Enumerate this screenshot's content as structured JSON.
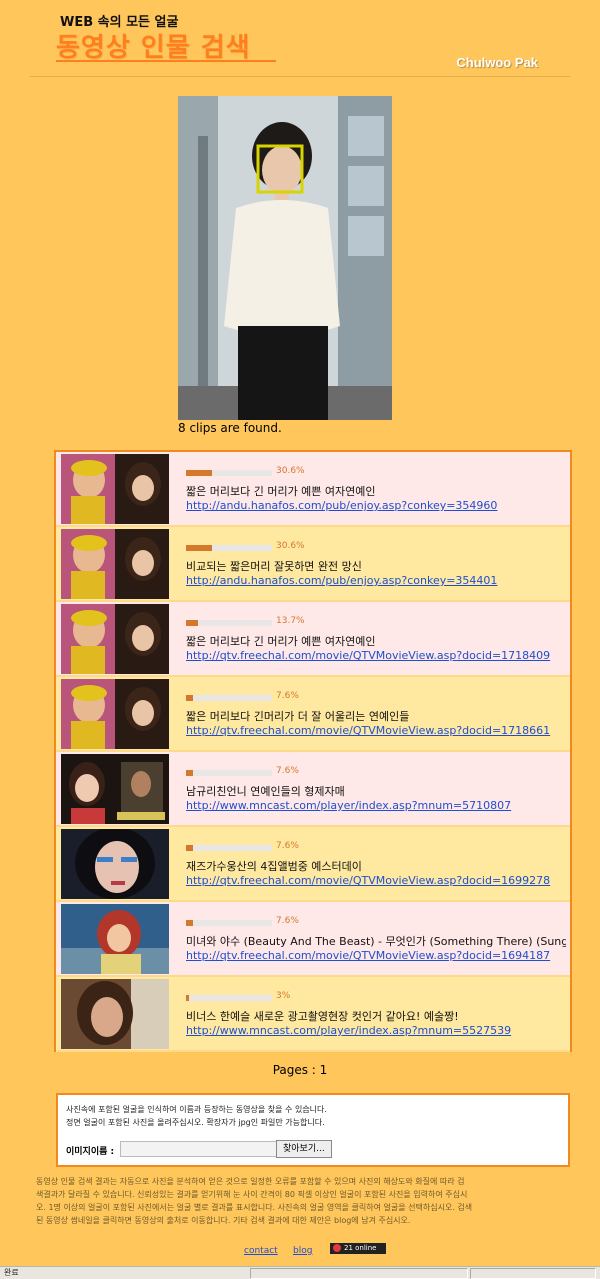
{
  "header": {
    "subtitle": "WEB 속의 모든 얼굴",
    "title": "동영상 인물 검색",
    "author": "Chulwoo Pak"
  },
  "query": {
    "clips_found": "8 clips are found."
  },
  "results": [
    {
      "percent": "30.6%",
      "score": 0.306,
      "title": "짧은 머리보다 긴 머리가 예쁜 여자연예인",
      "url": "http://andu.hanafos.com/pub/enjoy.asp?conkey=354960"
    },
    {
      "percent": "30.6%",
      "score": 0.306,
      "title": "비교되는 짧은머리 잘못하면 완전 망신",
      "url": "http://andu.hanafos.com/pub/enjoy.asp?conkey=354401"
    },
    {
      "percent": "13.7%",
      "score": 0.137,
      "title": "짧은 머리보다 긴 머리가 예쁜 여자연예인",
      "url": "http://qtv.freechal.com/movie/QTVMovieView.asp?docid=1718409"
    },
    {
      "percent": "7.6%",
      "score": 0.076,
      "title": "짧은 머리보다 긴머리가 더 잘 어울리는 연예인들",
      "url": "http://qtv.freechal.com/movie/QTVMovieView.asp?docid=1718661"
    },
    {
      "percent": "7.6%",
      "score": 0.076,
      "title": "남규리친언니 연예인들의 형제자매",
      "url": "http://www.mncast.com/player/index.asp?mnum=5710807"
    },
    {
      "percent": "7.6%",
      "score": 0.076,
      "title": "재즈가수웅산의 4집앨범중 예스터데이",
      "url": "http://qtv.freechal.com/movie/QTVMovieView.asp?docid=1699278"
    },
    {
      "percent": "7.6%",
      "score": 0.076,
      "title": "미녀와 야수 (Beauty And The Beast) - 무엇인가 (Something There) (Sung",
      "url": "http://qtv.freechal.com/movie/QTVMovieView.asp?docid=1694187"
    },
    {
      "percent": "3%",
      "score": 0.03,
      "title": "비너스 한예슬 새로운 광고촬영현장 컷인거 같아요! 예술짱!",
      "url": "http://www.mncast.com/player/index.asp?mnum=5527539"
    }
  ],
  "pagination": {
    "label": "Pages : 1"
  },
  "upload": {
    "hint_line1": "사진속에 포함된 얼굴을 인식하여 이름과 등장하는 동영상을 찾을 수 있습니다.",
    "hint_line2": "정면 얼굴이 포함된 사진을 올려주십시오. 확장자가 jpg인 파일만 가능합니다.",
    "label": "이미지이름 :",
    "file_value": "",
    "browse_label": "찾아보기..."
  },
  "notice": {
    "line1": "동영상 인물 검색 결과는 자동으로 사진을 분석하여 얻은 것으로 일정한 오류를 포함할 수 있으며 사진의 해상도와 화질에 따라 검",
    "line2": "색결과가 달라질 수 있습니다. 신뢰성있는 결과를 얻기위해 눈 사이 간격이 80 픽셀 이상인 얼굴이 포함된 사진을 입력하여 주십시",
    "line3": "오. 1명 이상의 얼굴이 포함된 사진에서는 얼굴 별로 결과를 표시합니다. 사진속의 얼굴 영역을 클릭하여 얼굴을 선택하십시오. 검색",
    "line4": "된 동영상 썸네일을 클릭하면 동영상의 출처로 이동합니다. 기타 검색 결과에 대한 제안은 blog에 남겨 주십시오."
  },
  "footer": {
    "contact": "contact",
    "blog": "blog",
    "badge": "21 online"
  },
  "statusbar": {
    "text": "완료"
  },
  "colors": {
    "page_bg": "#ffc65c",
    "accent": "#ff7f1e",
    "bar": "#d4782c",
    "link": "#1f4fd0"
  }
}
